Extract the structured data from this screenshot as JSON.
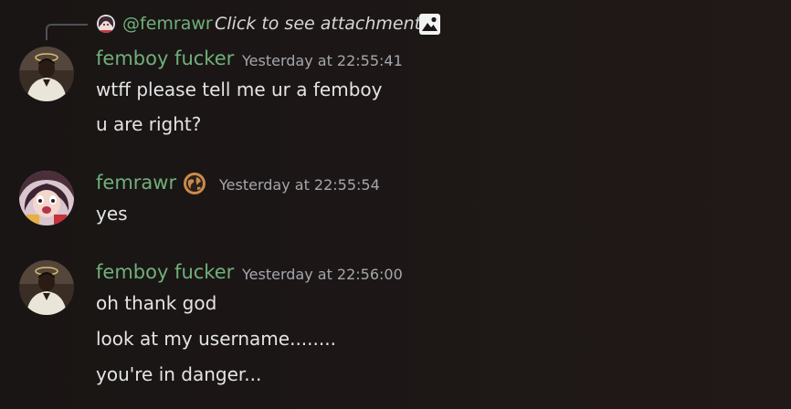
{
  "reply": {
    "mention": "@femrawr",
    "text": "Click to see attachment",
    "icon": "image-icon"
  },
  "messages": [
    {
      "author": "femboy fucker",
      "timestamp": "Yesterday at  22:55:41",
      "avatar": "avatar-femboy-fucker",
      "lines": [
        "wtff please tell me ur a femboy",
        "u are right?"
      ]
    },
    {
      "author": "femrawr",
      "timestamp": "Yesterday at  22:55:54",
      "avatar": "avatar-femrawr",
      "badge": "globe-icon",
      "lines": [
        "yes"
      ]
    },
    {
      "author": "femboy fucker",
      "timestamp": "Yesterday at  22:56:00",
      "avatar": "avatar-femboy-fucker",
      "lines": [
        "oh thank god",
        "look at my username........",
        "you're in danger..."
      ]
    }
  ],
  "colors": {
    "username": "#6fb07a",
    "background": "#1c1716",
    "text": "#e4e4e6",
    "timestamp": "#a4a7ad"
  }
}
